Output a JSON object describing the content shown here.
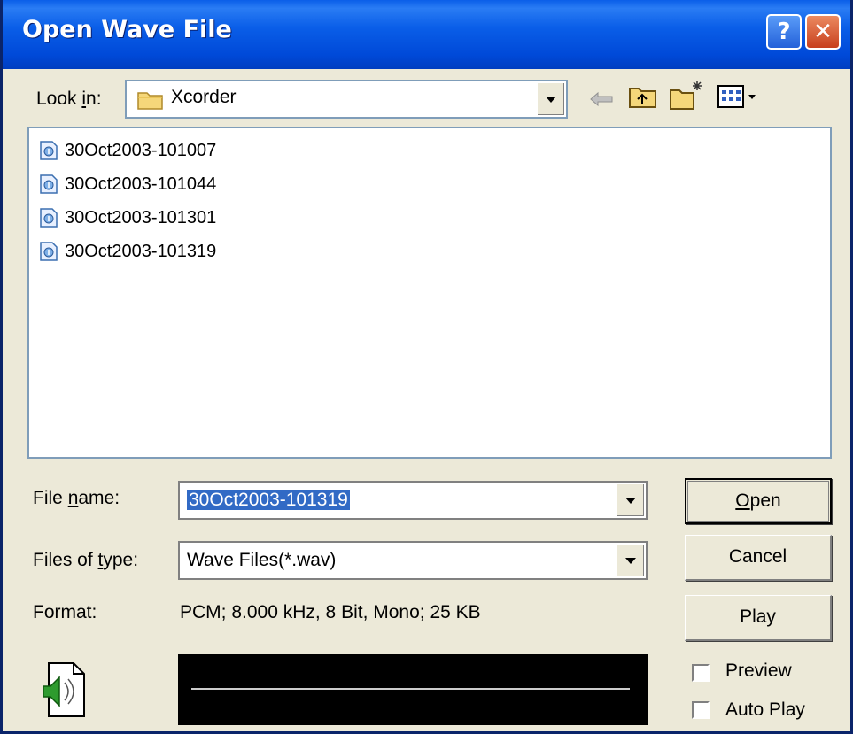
{
  "window": {
    "title": "Open Wave File",
    "help_label": "?",
    "close_label": "✕"
  },
  "look_in": {
    "label_pre": "Look ",
    "label_u": "i",
    "label_post": "n:",
    "value": "Xcorder"
  },
  "toolbar": {
    "icons": [
      "back-arrow-icon",
      "up-folder-icon",
      "new-folder-icon",
      "view-menu-icon"
    ]
  },
  "files": [
    {
      "name": "30Oct2003-101007"
    },
    {
      "name": "30Oct2003-101044"
    },
    {
      "name": "30Oct2003-101301"
    },
    {
      "name": "30Oct2003-101319"
    }
  ],
  "file_name": {
    "label_pre": "File ",
    "label_u": "n",
    "label_post": "ame:",
    "value": "30Oct2003-101319"
  },
  "file_type": {
    "label_pre": "Files of ",
    "label_u": "t",
    "label_post": "ype:",
    "value": "Wave Files(*.wav)"
  },
  "format": {
    "label": "Format:",
    "value": "PCM; 8.000 kHz, 8 Bit, Mono; 25 KB"
  },
  "buttons": {
    "open_u": "O",
    "open_rest": "pen",
    "cancel": "Cancel",
    "play": "Play"
  },
  "options": {
    "preview": "Preview",
    "auto_play": "Auto Play"
  },
  "colors": {
    "title_bar": "#0a5ee8",
    "selection": "#316ac5",
    "dialog_bg": "#ece9d8"
  }
}
